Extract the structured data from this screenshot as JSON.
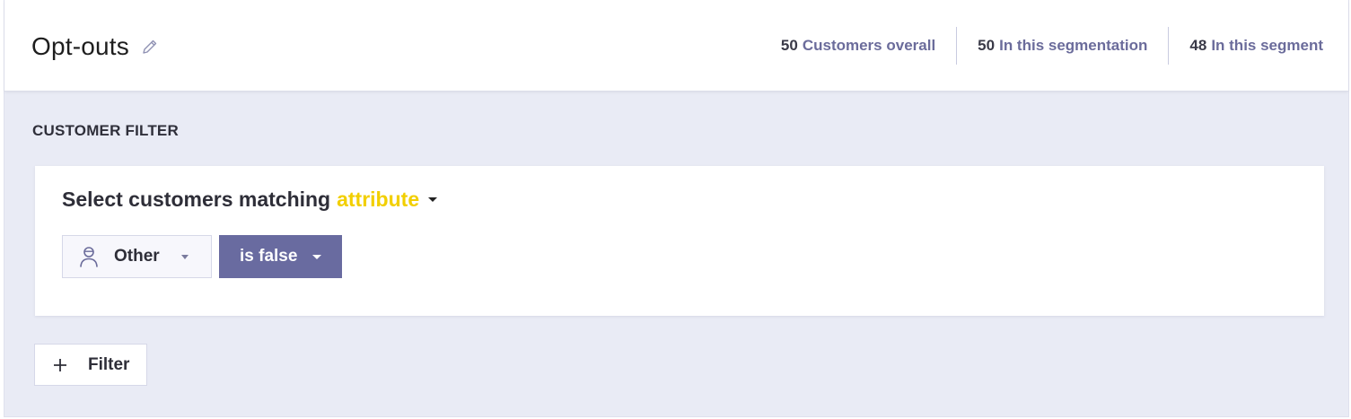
{
  "header": {
    "title": "Opt-outs",
    "edit_icon": "pencil-icon",
    "stats": [
      {
        "count": "50",
        "label": "Customers overall"
      },
      {
        "count": "50",
        "label": "In this segmentation"
      },
      {
        "count": "48",
        "label": "In this segment"
      }
    ]
  },
  "section": {
    "label": "CUSTOMER FILTER"
  },
  "filter": {
    "heading_prefix": "Select customers matching",
    "heading_highlight": "attribute",
    "attribute": {
      "icon": "person-icon",
      "label": "Other"
    },
    "condition": {
      "label": "is false"
    }
  },
  "add_filter": {
    "icon": "plus-icon",
    "label": "Filter"
  },
  "colors": {
    "accent": "#696ba0",
    "highlight": "#f2cf00",
    "stat_label": "#6b6c9b",
    "background": "#e9ebf5"
  }
}
